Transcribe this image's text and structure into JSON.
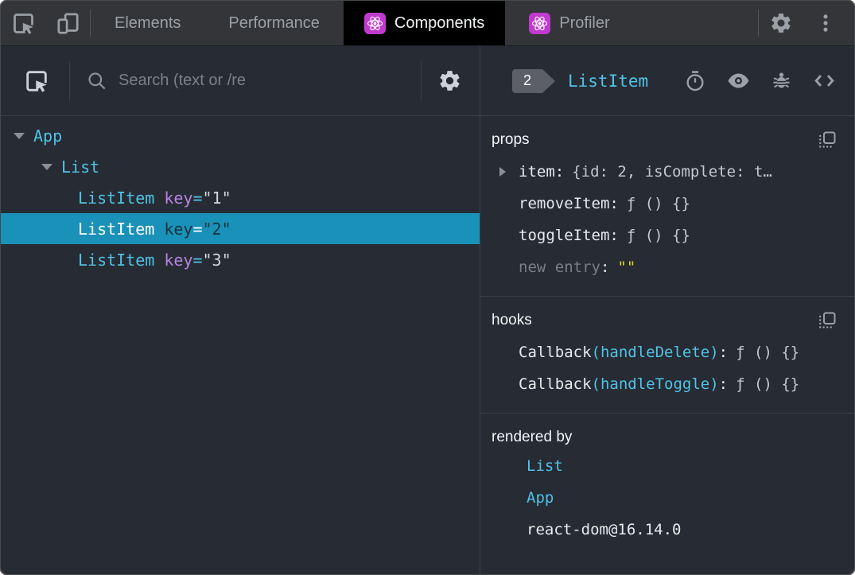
{
  "colors": {
    "topbar_bg": "#343539",
    "panel_bg": "#272b33",
    "border": "#3a3f48",
    "tab_text": "#9aa0a6",
    "active_tab_bg": "#000000",
    "active_tab_text": "#f1f3f4",
    "react_icon_bg": "#c03acf",
    "accent_cyan": "#4fc3e6",
    "attr_purple": "#b784e0",
    "attr_value_gray": "#d2d7dd",
    "selection_bg": "#1a91b8",
    "selection_text": "#ffffff",
    "selection_dark": "#17333e",
    "name_text": "#e8eaed",
    "value_gray": "#c0c9d2",
    "muted_text": "#787f88",
    "yellow_value": "#d8d818",
    "icon_gray": "#9aa1ab",
    "badge_bg": "#5c6066"
  },
  "strings": {
    "eq": "=",
    "colon": ":"
  },
  "topbar": {
    "tabs": {
      "elements": "Elements",
      "performance": "Performance",
      "components": "Components",
      "profiler": "Profiler"
    }
  },
  "left_toolbar": {
    "search_placeholder": "Search (text or /re"
  },
  "tree": {
    "nodes": [
      {
        "label": "App"
      },
      {
        "label": "List"
      },
      {
        "label": "ListItem",
        "attr_name": "key",
        "attr_value": "\"1\""
      },
      {
        "label": "ListItem",
        "attr_name": "key",
        "attr_value": "\"2\"",
        "selected": true
      },
      {
        "label": "ListItem",
        "attr_name": "key",
        "attr_value": "\"3\""
      }
    ]
  },
  "inspector": {
    "badge": "2",
    "component": "ListItem",
    "props_title": "props",
    "props_rows": [
      {
        "name": "item",
        "value": "{id: 2, isComplete: t…"
      },
      {
        "name": "removeItem",
        "value": "ƒ () {}"
      },
      {
        "name": "toggleItem",
        "value": "ƒ () {}"
      },
      {
        "name": "new entry",
        "value": "\"\""
      }
    ],
    "hooks_title": "hooks",
    "hooks_rows": [
      {
        "name": "Callback",
        "sub": "(handleDelete)",
        "value": "ƒ () {}"
      },
      {
        "name": "Callback",
        "sub": "(handleToggle)",
        "value": "ƒ () {}"
      }
    ],
    "rendered_by_title": "rendered by",
    "rendered_by": [
      "List",
      "App",
      "react-dom@16.14.0"
    ]
  }
}
